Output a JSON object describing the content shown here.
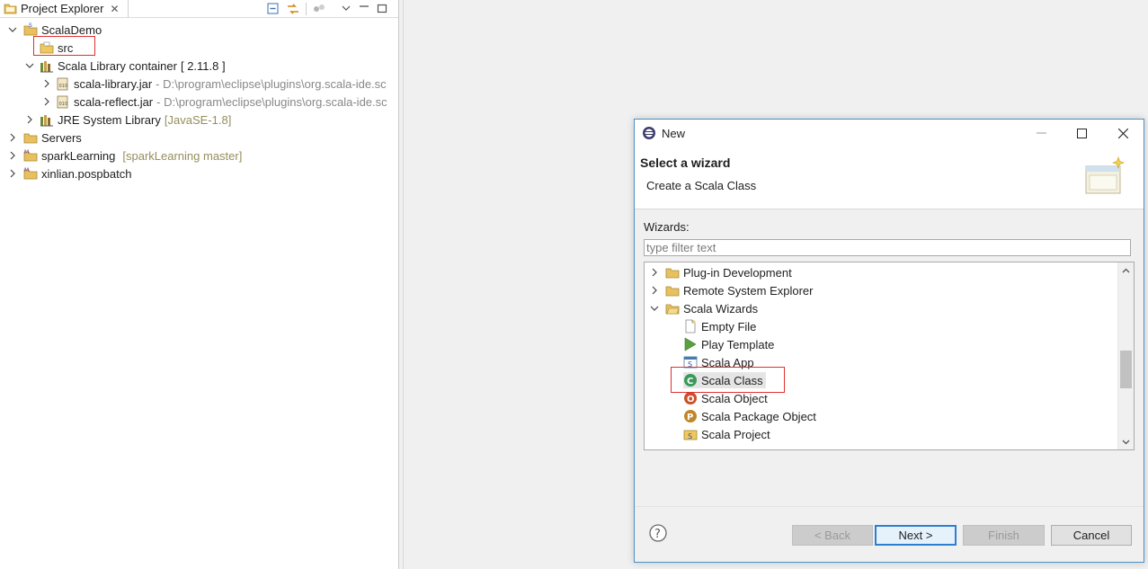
{
  "explorer": {
    "tab_label": "Project Explorer",
    "tree": [
      {
        "label": "ScalaDemo"
      },
      {
        "label": "src"
      },
      {
        "label": "Scala Library container",
        "deco": "[ 2.11.8 ]"
      },
      {
        "label": "scala-library.jar",
        "path": "- D:\\program\\eclipse\\plugins\\org.scala-ide.sc"
      },
      {
        "label": "scala-reflect.jar",
        "path": "- D:\\program\\eclipse\\plugins\\org.scala-ide.sc"
      },
      {
        "label": "JRE System Library",
        "deco": "[JavaSE-1.8]"
      },
      {
        "label": "Servers"
      },
      {
        "label": "sparkLearning",
        "deco": "[sparkLearning master]"
      },
      {
        "label": "xinlian.pospbatch"
      }
    ]
  },
  "dialog": {
    "title": "New",
    "heading": "Select a wizard",
    "subtitle": "Create a Scala Class",
    "wizards_label": "Wizards:",
    "filter_placeholder": "type filter text",
    "items": [
      {
        "label": "Plug-in Development"
      },
      {
        "label": "Remote System Explorer"
      },
      {
        "label": "Scala Wizards"
      },
      {
        "label": "Empty File"
      },
      {
        "label": "Play Template"
      },
      {
        "label": "Scala App"
      },
      {
        "label": "Scala Class"
      },
      {
        "label": "Scala Object"
      },
      {
        "label": "Scala Package Object"
      },
      {
        "label": "Scala Project"
      }
    ],
    "buttons": {
      "back": "< Back",
      "next": "Next >",
      "finish": "Finish",
      "cancel": "Cancel"
    }
  },
  "colors": {
    "highlight_box": "#e03030",
    "default_button_border": "#2d7fd2",
    "folder": "#e8c060"
  }
}
